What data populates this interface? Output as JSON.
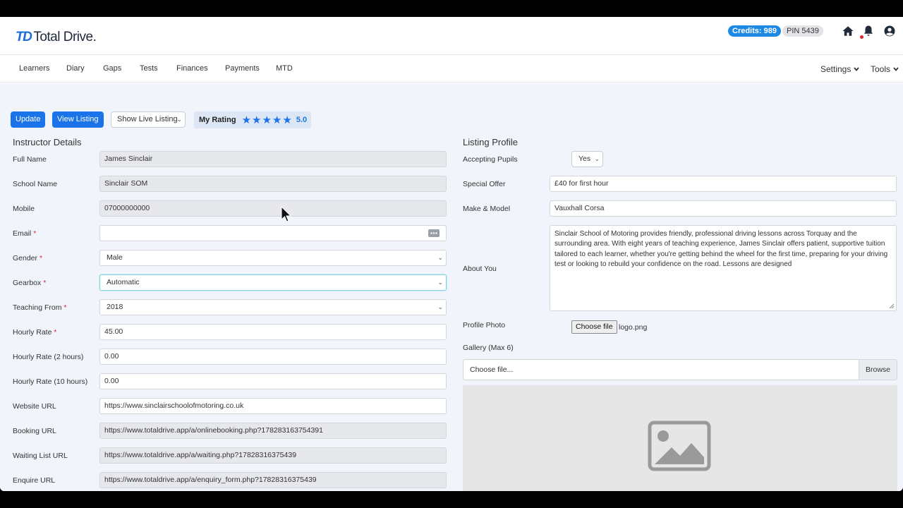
{
  "app": {
    "logo_mark": "TD",
    "logo_text": "Total Drive."
  },
  "header": {
    "credits": "Credits: 989",
    "pin": "PIN 5439"
  },
  "icons": {
    "home": "home-icon",
    "bell": "bell-icon",
    "user": "user-circle-icon"
  },
  "nav": {
    "items": [
      "Learners",
      "Diary",
      "Gaps",
      "Tests",
      "Finances",
      "Payments",
      "MTD"
    ],
    "settings": "Settings",
    "tools": "Tools"
  },
  "toolbar": {
    "update": "Update",
    "view_listing": "View Listing",
    "show_live_listing": "Show Live Listing",
    "rating_label": "My Rating",
    "rating_value": "5.0",
    "stars": 5
  },
  "instructor": {
    "title": "Instructor Details",
    "fields": [
      {
        "label": "Full Name",
        "required": false,
        "value": "James Sinclair"
      },
      {
        "label": "School Name",
        "required": false,
        "value": "Sinclair SOM"
      },
      {
        "label": "Mobile",
        "required": false,
        "value": "07000000000"
      },
      {
        "label": "Email",
        "required": true,
        "value": ""
      },
      {
        "label": "Gender",
        "required": true,
        "value": "Male"
      },
      {
        "label": "Gearbox",
        "required": true,
        "value": "Automatic"
      },
      {
        "label": "Teaching From",
        "required": true,
        "value": "2018"
      },
      {
        "label": "Hourly Rate",
        "required": true,
        "value": "45.00"
      },
      {
        "label": "Hourly Rate (2 hours)",
        "required": false,
        "value": "0.00"
      },
      {
        "label": "Hourly Rate (10 hours)",
        "required": false,
        "value": "0.00"
      },
      {
        "label": "Website URL",
        "required": false,
        "value": "https://www.sinclairschoolofmotoring.co.uk"
      },
      {
        "label": "Booking URL",
        "required": false,
        "value": "https://www.totaldrive.app/a/onlinebooking.php?178283163754391"
      },
      {
        "label": "Waiting List URL",
        "required": false,
        "value": "https://www.totaldrive.app/a/waiting.php?17828316375439"
      },
      {
        "label": "Enquire URL",
        "required": false,
        "value": "https://www.totaldrive.app/a/enquiry_form.php?17828316375439"
      }
    ],
    "required_mark": "*"
  },
  "listing": {
    "title": "Listing Profile",
    "accepting_pupils_label": "Accepting Pupils",
    "accepting_pupils_value": "Yes",
    "special_offer_label": "Special Offer",
    "special_offer_value": "£40 for first hour",
    "make_model_label": "Make & Model",
    "make_model_value": "Vauxhall Corsa",
    "about_label": "About You",
    "about_value": "Sinclair School of Motoring provides friendly, professional driving lessons across Torquay and the surrounding area. With eight years of teaching experience, James Sinclair offers patient, supportive tuition tailored to each learner, whether you're getting behind the wheel for the first time, preparing for your driving test or looking to rebuild your confidence on the road. Lessons are designed",
    "profile_photo_label": "Profile Photo",
    "choose_file": "Choose file",
    "file_name": "logo.png",
    "gallery_label": "Gallery (Max 6)",
    "gallery_placeholder": "Choose file...",
    "browse": "Browse"
  },
  "colors": {
    "accent": "#1a73e8",
    "required": "#d9263a",
    "background": "#f1f4fb"
  }
}
